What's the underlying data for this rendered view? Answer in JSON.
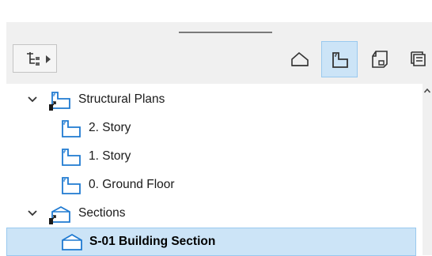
{
  "toolbar": {
    "navigator_button_icon": "project-map-icon",
    "view_buttons": [
      {
        "icon": "project-map-icon",
        "active": false
      },
      {
        "icon": "view-map-icon",
        "active": true
      },
      {
        "icon": "layout-book-icon",
        "active": false
      },
      {
        "icon": "publisher-sets-icon",
        "active": false
      }
    ]
  },
  "tree": {
    "items": [
      {
        "label": "Structural Plans",
        "type": "folder",
        "expanded": true,
        "icon": "floor-plan-folder-icon"
      },
      {
        "label": "2. Story",
        "type": "view",
        "icon": "floor-plan-icon"
      },
      {
        "label": "1. Story",
        "type": "view",
        "icon": "floor-plan-icon"
      },
      {
        "label": "0. Ground Floor",
        "type": "view",
        "icon": "floor-plan-icon"
      },
      {
        "label": "Sections",
        "type": "folder",
        "expanded": true,
        "icon": "section-folder-icon"
      },
      {
        "label": "S-01 Building Section",
        "type": "view",
        "selected": true,
        "icon": "section-icon"
      }
    ]
  },
  "colors": {
    "accent_blue": "#1f7ad1",
    "selection_bg": "#cce4f7",
    "selection_border": "#99c9ef",
    "panel_bg": "#f0f0f0"
  }
}
